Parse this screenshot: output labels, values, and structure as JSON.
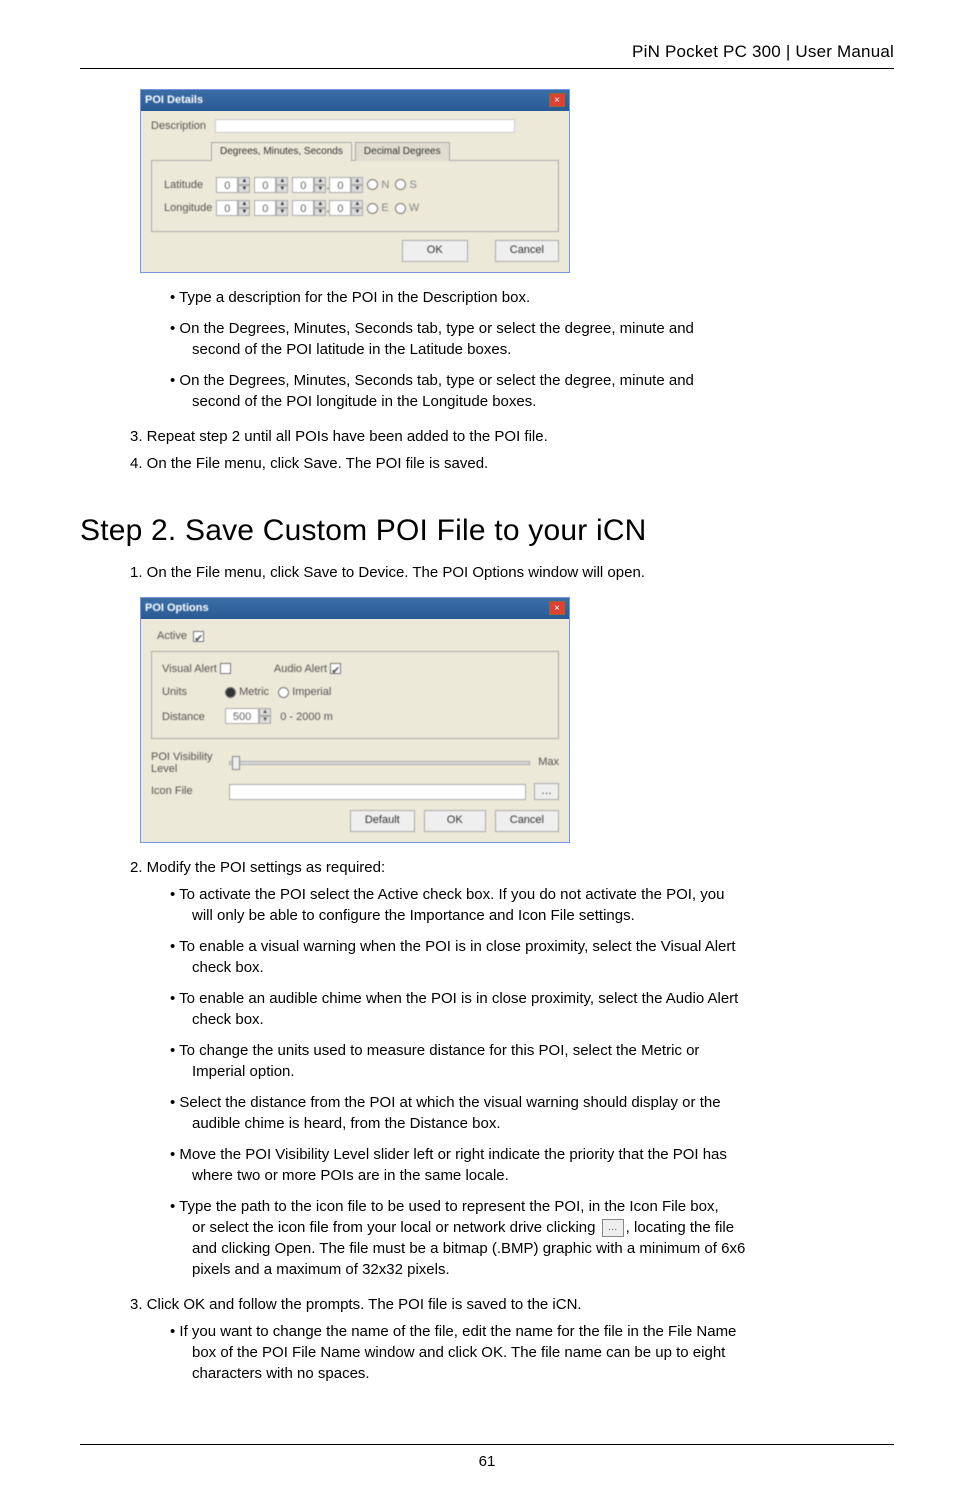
{
  "doc_header": "PiN Pocket PC 300 | User Manual",
  "page_number": "61",
  "dlg1": {
    "title": "POI Details",
    "tab1": "Degrees, Minutes, Seconds",
    "tab2": "Decimal Degrees",
    "row1_label": "Description",
    "lat_label": "Latitude",
    "lon_label": "Longitude",
    "nsew_n": "N",
    "nsew_s": "S",
    "nsew_e": "E",
    "nsew_w": "W",
    "ok": "OK",
    "cancel": "Cancel"
  },
  "list1": {
    "b1": "• Type a description for the POI in the Description box.",
    "b2": "• On the Degrees, Minutes, Seconds tab, type or select the degree, minute and",
    "b2c": "second of the POI latitude in the Latitude boxes.",
    "b3": "• On the Degrees, Minutes, Seconds tab, type or select the degree, minute and",
    "b3c": "second of the POI longitude in the Longitude boxes."
  },
  "steps_a": {
    "s3": "3. Repeat step 2 until all POIs have been added to the POI file.",
    "s4": "4. On the File menu, click Save. The POI file is saved."
  },
  "section_title": "Step 2. Save Custom POI File to your iCN",
  "steps_b": {
    "s1": "1. On the File menu, click Save to Device. The POI Options window will open."
  },
  "dlg2": {
    "title": "POI Options",
    "active": "Active",
    "visual_alert": "Visual Alert",
    "audio_alert": "Audio Alert",
    "units": "Units",
    "metric": "Metric",
    "imperial": "Imperial",
    "distance": "Distance",
    "distance_val": "500",
    "distance_range": "0 - 2000 m",
    "vis_level": "POI Visibility Level",
    "max": "Max",
    "icon_file": "Icon File",
    "default": "Default",
    "ok": "OK",
    "cancel": "Cancel"
  },
  "steps_c": {
    "s2": "2. Modify the POI settings as required:"
  },
  "list2": {
    "b1": "• To activate the POI select the Active check box. If you do not activate the POI, you",
    "b1c": "will only be able to configure the Importance and Icon File settings.",
    "b2": "• To enable a visual warning when the POI is in close proximity, select the Visual Alert",
    "b2c": "check box.",
    "b3": "• To enable an audible chime when the POI is in close proximity, select the Audio Alert",
    "b3c": "check box.",
    "b4": "• To change the units used to measure distance for this POI, select the Metric or",
    "b4c": "Imperial option.",
    "b5": "• Select the distance from the POI at which the visual warning should display or the",
    "b5c": "audible chime is heard, from the Distance box.",
    "b6": "• Move the POI Visibility Level slider left or right indicate the priority that the POI has",
    "b6c": "where two or more POIs are in the same locale.",
    "b7": "• Type the path to the icon file to be used to represent the POI, in the Icon File box,",
    "b7b_pre": "or select the icon file from your local or network drive clicking ",
    "b7b_post": ", locating the file",
    "b7c": "and clicking Open. The file must be a bitmap (.BMP)  graphic with a minimum of 6x6",
    "b7d": "pixels and a maximum of 32x32 pixels."
  },
  "steps_d": {
    "s3": "3. Click OK and follow the prompts. The POI file is saved to the iCN."
  },
  "list3": {
    "b1": "• If you want to change the name of the file, edit the name for the file in the File Name",
    "b1c": "box of the POI File Name window and click OK. The file name can be up to eight",
    "b1d": "characters with no spaces."
  },
  "browse_icon_glyph": "…"
}
